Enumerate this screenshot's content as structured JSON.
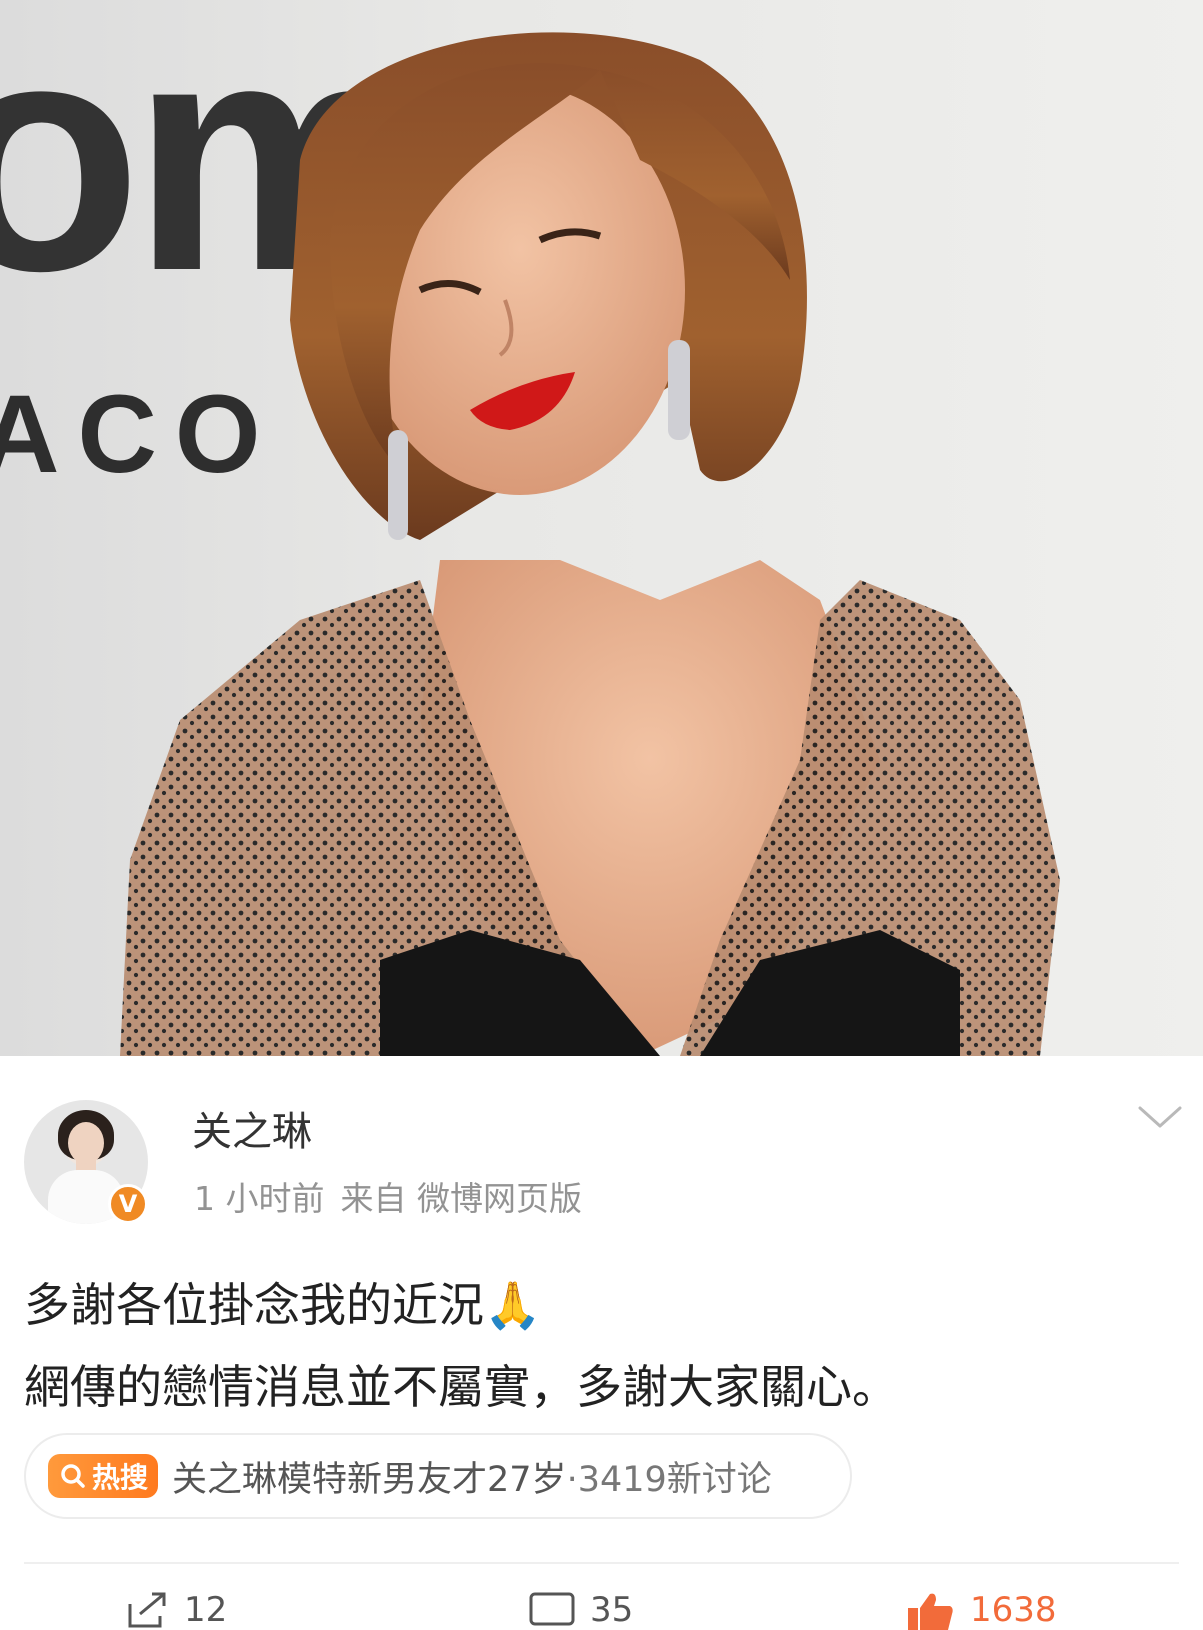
{
  "photo": {
    "backdrop_logo_text": "om",
    "backdrop_sub_text": "ACO"
  },
  "post": {
    "username": "关之琳",
    "time": "1 小时前",
    "source": "来自 微博网页版",
    "verified_label": "V",
    "content_lines": [
      "多謝各位掛念我的近況🙏",
      "網傳的戀情消息並不屬實，多謝大家關心。"
    ]
  },
  "hot_search": {
    "tag": "热搜",
    "topic": "关之琳模特新男友才27岁",
    "count": "·3419新讨论"
  },
  "actions": {
    "share_count": "12",
    "comment_count": "35",
    "like_count": "1638"
  },
  "colors": {
    "badge": "#f08a24",
    "hot_tag": "#ff8a2a",
    "lipstick": "#d01818"
  }
}
